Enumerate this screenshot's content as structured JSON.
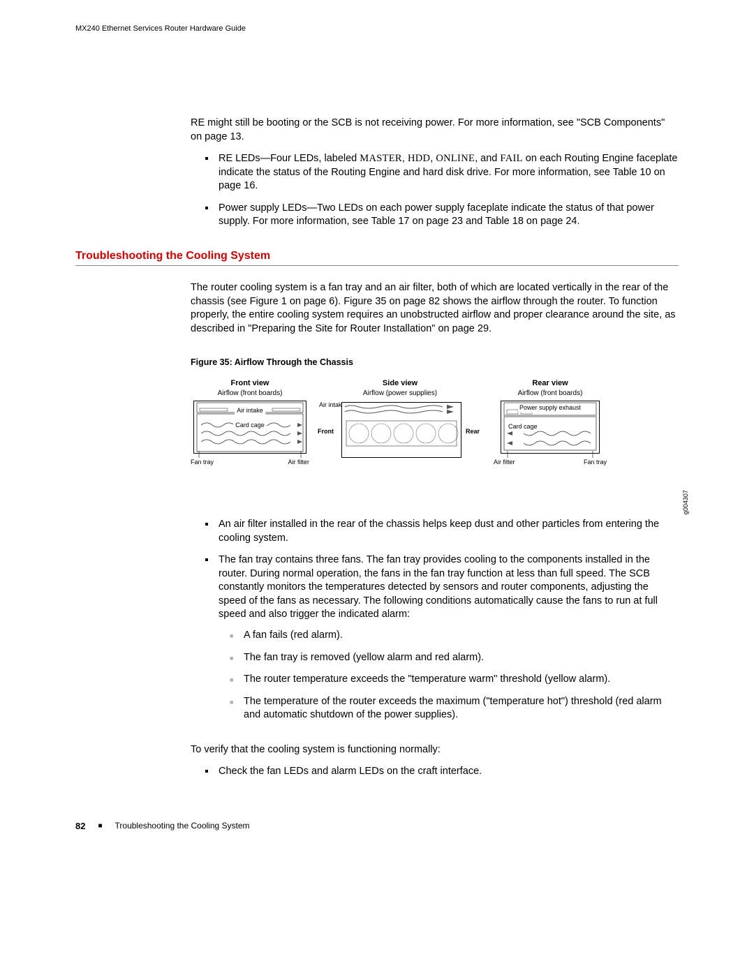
{
  "header": {
    "running": "MX240 Ethernet Services Router Hardware Guide"
  },
  "intro": {
    "continued": "RE might still be booting or the SCB is not receiving power. For more information, see \"SCB Components\" on page 13.",
    "bullet1_a": "RE LEDs—Four LEDs, labeled ",
    "bullet1_master": "MASTER",
    "bullet1_sep1": ", ",
    "bullet1_hdd": "HDD",
    "bullet1_sep2": ", ",
    "bullet1_online": "ONLINE",
    "bullet1_sep3": ", and ",
    "bullet1_fail": "FAIL",
    "bullet1_b": " on each Routing Engine faceplate indicate the status of the Routing Engine and hard disk drive. For more information, see Table 10 on page 16.",
    "bullet2": "Power supply LEDs—Two LEDs on each power supply faceplate indicate the status of that power supply. For more information, see Table 17 on page 23 and Table 18 on page 24."
  },
  "section": {
    "title": "Troubleshooting the Cooling System",
    "para1": "The router cooling system is a fan tray and an air filter, both of which are located vertically in the rear of the chassis (see Figure 1 on page 6). Figure 35 on page 82 shows the airflow through the router. To function properly, the entire cooling system requires an unobstructed airflow and proper clearance around the site, as described in \"Preparing the Site for Router Installation\" on page 29."
  },
  "figure": {
    "caption": "Figure 35: Airflow Through the Chassis",
    "id": "g004307",
    "front": {
      "title": "Front view",
      "sub": "Airflow (front boards)",
      "air_intake": "Air intake",
      "card_cage": "Card cage",
      "fan_tray": "Fan tray",
      "air_filter": "Air filter"
    },
    "side": {
      "title": "Side view",
      "sub": "Airflow (power supplies)",
      "air_intake": "Air intake",
      "front": "Front",
      "rear": "Rear"
    },
    "rear": {
      "title": "Rear view",
      "sub": "Airflow (front boards)",
      "ps_exhaust": "Power supply exhaust",
      "card_cage": "Card cage",
      "air_filter": "Air filter",
      "fan_tray": "Fan tray"
    }
  },
  "bullets2": {
    "b1": "An air filter installed in the rear of the chassis helps keep dust and other particles from entering the cooling system.",
    "b2": "The fan tray contains three fans. The fan tray provides cooling to the components installed in the router. During normal operation, the fans in the fan tray function at less than full speed. The SCB constantly monitors the temperatures detected by sensors and router components, adjusting the speed of the fans as necessary. The following conditions automatically cause the fans to run at full speed and also trigger the indicated alarm:",
    "inner1": "A fan fails (red alarm).",
    "inner2": "The fan tray is removed (yellow alarm and red alarm).",
    "inner3": "The router temperature exceeds the \"temperature warm\" threshold (yellow alarm).",
    "inner4": "The temperature of the router exceeds the maximum (\"temperature hot\") threshold (red alarm and automatic shutdown of the power supplies)."
  },
  "verify": {
    "para": "To verify that the cooling system is functioning normally:",
    "b1": "Check the fan LEDs and alarm LEDs on the craft interface."
  },
  "footer": {
    "page": "82",
    "text": "Troubleshooting the Cooling System"
  }
}
